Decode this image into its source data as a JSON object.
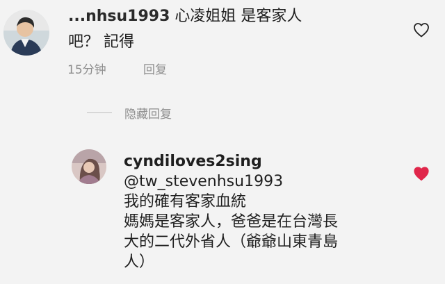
{
  "comment": {
    "username_partial": "...nhsu1993",
    "text_line1": "心凌姐姐 是客家人",
    "text_line2": "吧？ 記得",
    "time": "15分钟",
    "reply_label": "回复"
  },
  "hidden_replies_label": "隐藏回复",
  "reply": {
    "username": "cyndiloves2sing",
    "mention": "@tw_stevenhsu1993",
    "lines": [
      "我的確有客家血統",
      "媽媽是客家人，爸爸是在台灣長",
      "大的二代外省人（爺爺山東青島",
      "人）"
    ]
  },
  "icons": {
    "comment_like": "heart-outline-icon",
    "reply_like": "heart-filled-icon"
  },
  "colors": {
    "background": "#f3f3f3",
    "muted_text": "#8e8e8e",
    "liked_heart": "#e0264a"
  }
}
